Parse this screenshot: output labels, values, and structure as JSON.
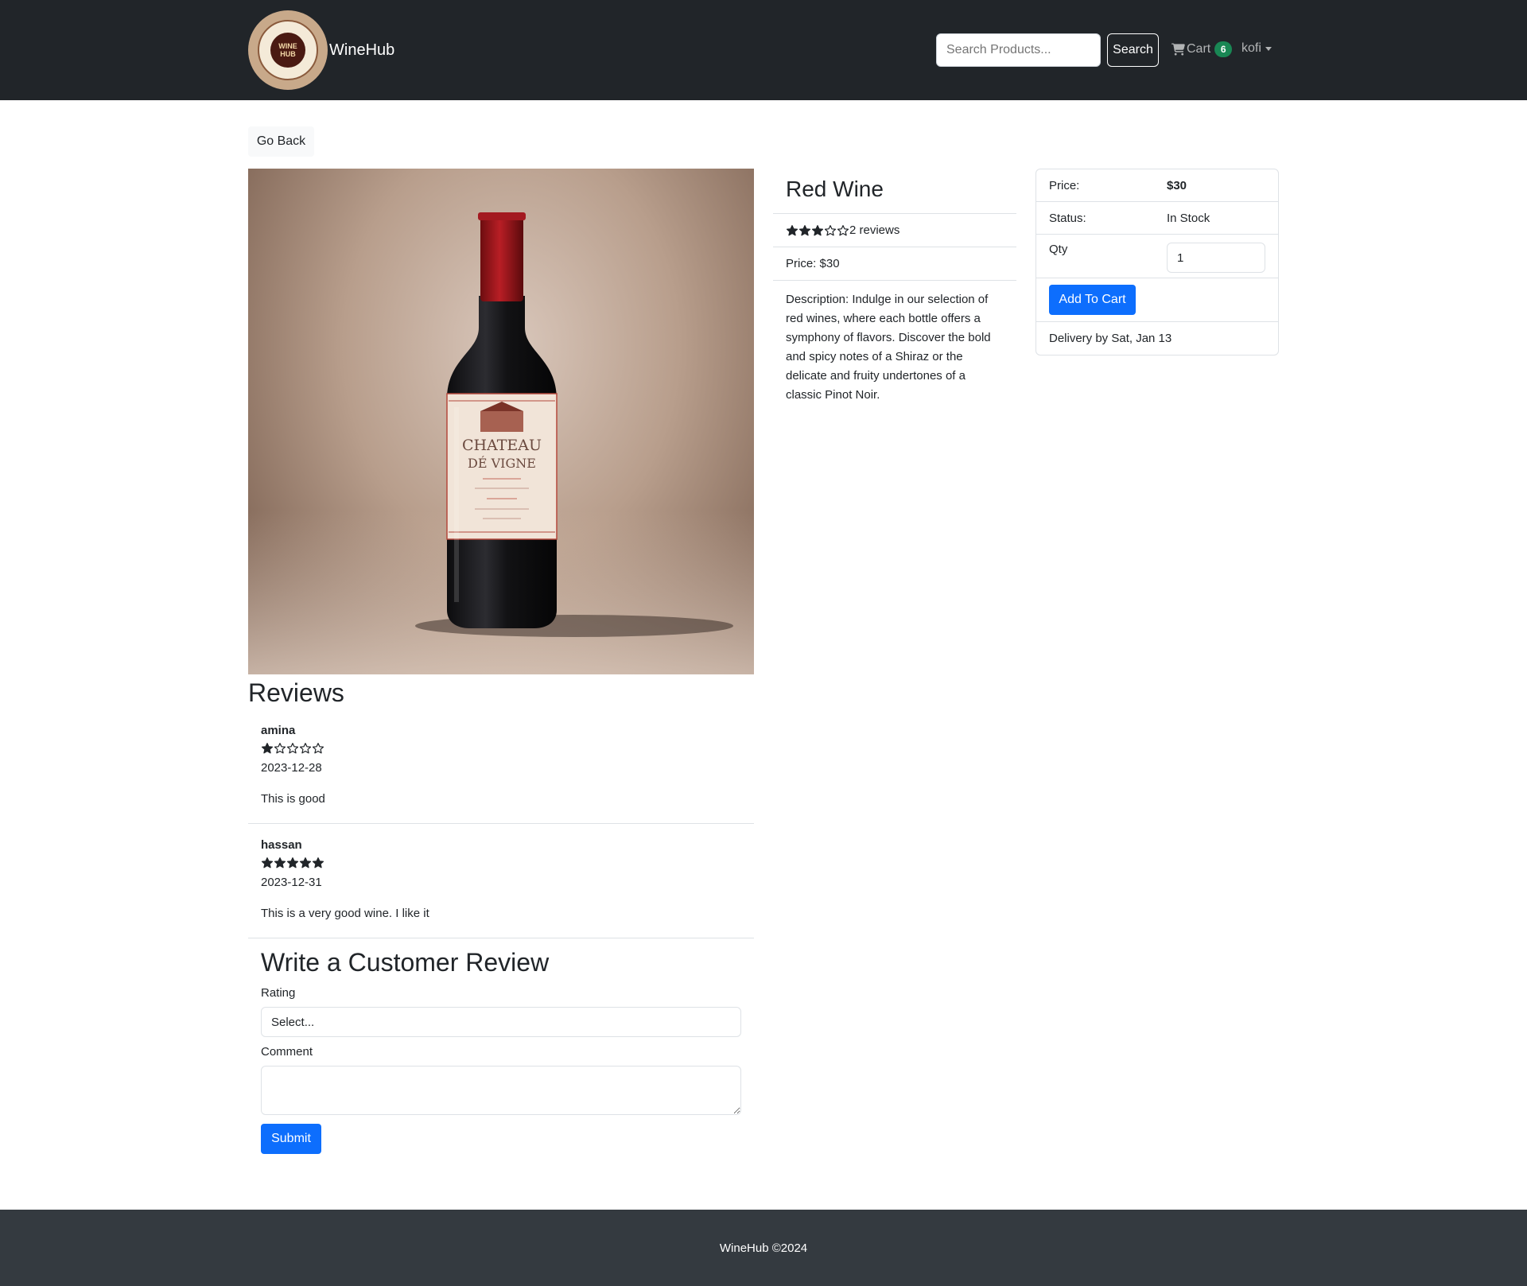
{
  "brand": {
    "name": "WineHub",
    "logo_text": "WINE HUB"
  },
  "header": {
    "search_placeholder": "Search Products...",
    "search_button": "Search",
    "cart_label": "Cart",
    "cart_count": "6",
    "user_name": "kofi"
  },
  "go_back": "Go Back",
  "product": {
    "image_label_line1": "CHATEAU",
    "image_label_line2": "DÉ VIGNE",
    "name": "Red Wine",
    "rating": 3,
    "max_rating": 5,
    "reviews_text": "2 reviews",
    "price_text": "Price: $30",
    "description": "Description: Indulge in our selection of red wines, where each bottle offers a symphony of flavors. Discover the bold and spicy notes of a Shiraz or the delicate and fruity undertones of a classic Pinot Noir."
  },
  "card": {
    "price_label": "Price:",
    "price_value": "$30",
    "status_label": "Status:",
    "status_value": "In Stock",
    "qty_label": "Qty",
    "qty_value": "1",
    "add_button": "Add To Cart",
    "delivery": "Delivery by Sat, Jan 13"
  },
  "reviews": {
    "title": "Reviews",
    "items": [
      {
        "author": "amina",
        "rating": 1,
        "date": "2023-12-28",
        "comment": "This is good"
      },
      {
        "author": "hassan",
        "rating": 5,
        "date": "2023-12-31",
        "comment": "This is a very good wine. I like it"
      }
    ]
  },
  "write_review": {
    "title": "Write a Customer Review",
    "rating_label": "Rating",
    "rating_placeholder": "Select...",
    "comment_label": "Comment",
    "submit": "Submit"
  },
  "footer": {
    "text": "WineHub ©2024"
  },
  "colors": {
    "navbar": "#212529",
    "primary": "#0d6efd",
    "badge": "#198754",
    "footer": "#343a40"
  }
}
